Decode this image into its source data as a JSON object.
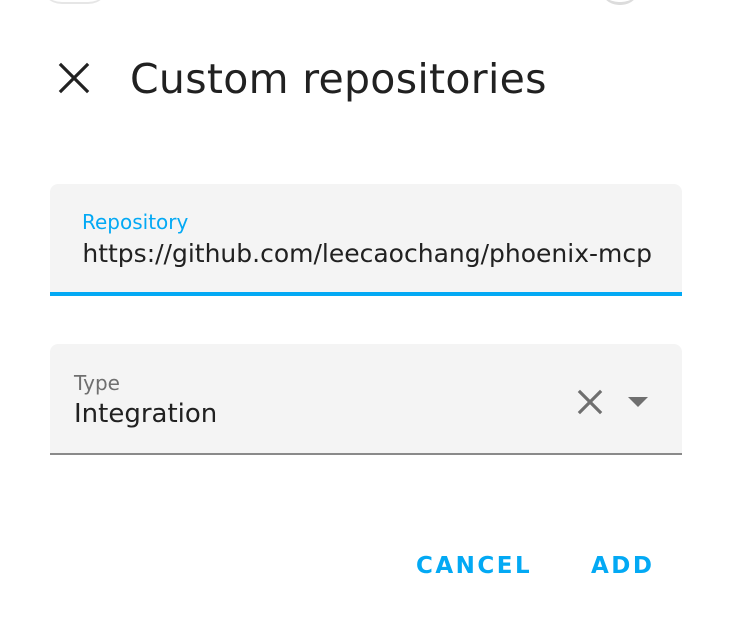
{
  "dialog": {
    "title": "Custom repositories",
    "close_icon": "close-icon"
  },
  "repository": {
    "label": "Repository",
    "value": "https://github.com/leecaochang/phoenix-mcp",
    "focused": true,
    "accent_color": "#03a9f4"
  },
  "type": {
    "label": "Type",
    "value": "Integration",
    "clear_icon": "clear-icon",
    "dropdown_icon": "dropdown-arrow-icon"
  },
  "actions": {
    "cancel_label": "CANCEL",
    "add_label": "ADD",
    "color": "#03a9f4"
  }
}
